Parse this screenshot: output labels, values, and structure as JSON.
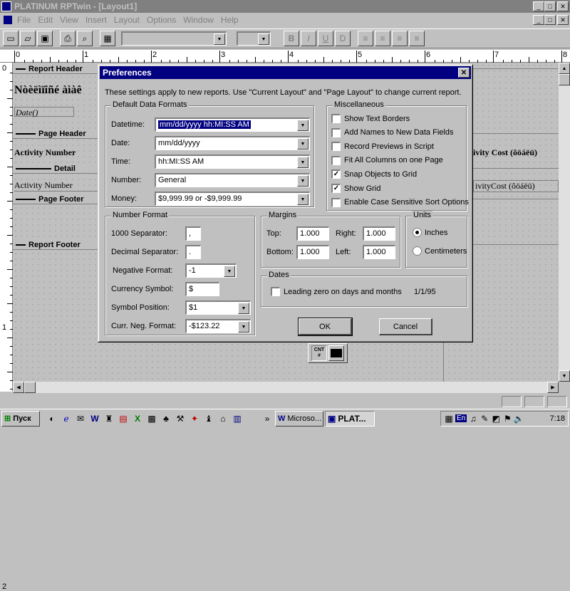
{
  "app": {
    "title": "PLATINUM RPTwin - [Layout1]",
    "win_min": "_",
    "win_max": "□",
    "win_close": "✕"
  },
  "menu": [
    "File",
    "Edit",
    "View",
    "Insert",
    "Layout",
    "Options",
    "Window",
    "Help"
  ],
  "toolbar": {
    "bold": "B",
    "italic": "I",
    "underline": "U",
    "strike": "D"
  },
  "ruler": {
    "labels": [
      "0",
      "1",
      "2",
      "3",
      "4",
      "5",
      "6",
      "7",
      "8"
    ],
    "vertical_labels": [
      "0",
      "1",
      "2"
    ]
  },
  "report": {
    "sections": [
      "Report Header",
      "Page Header",
      "Detail",
      "Page Footer",
      "Report Footer"
    ],
    "title_text": "Nòèëìïîñé àìàê",
    "date_text": "Date()",
    "col_left_header": "Activity Number",
    "col_right_header": "ivity Cost (ôöáëü)",
    "detail_left": "Activity Number",
    "detail_right": "ivityCost (ôöáëü)",
    "tool_cnt": "CNT #"
  },
  "dialog": {
    "title": "Preferences",
    "close": "✕",
    "description": "These settings apply to new reports.  Use \"Current Layout\" and \"Page Layout\" to change current report.",
    "default_formats": {
      "label": "Default Data Formats",
      "rows": [
        {
          "label": "Datetime:",
          "value": "mm/dd/yyyy hh:MI:SS AM"
        },
        {
          "label": "Date:",
          "value": "mm/dd/yyyy"
        },
        {
          "label": "Time:",
          "value": "hh:MI:SS AM"
        },
        {
          "label": "Number:",
          "value": "General"
        },
        {
          "label": "Money:",
          "value": "$9,999.99 or -$9,999.99"
        }
      ]
    },
    "misc": {
      "label": "Miscellaneous",
      "items": [
        {
          "label": "Show Text Borders",
          "checked": false
        },
        {
          "label": "Add Names to New Data Fields",
          "checked": false
        },
        {
          "label": "Record Previews in Script",
          "checked": false
        },
        {
          "label": "Fit All Columns on one Page",
          "checked": false
        },
        {
          "label": "Snap Objects to Grid",
          "checked": true
        },
        {
          "label": "Show Grid",
          "checked": true
        },
        {
          "label": "Enable Case Sensitive Sort Options",
          "checked": false
        }
      ]
    },
    "number_format": {
      "label": "Number Format",
      "thousand_label": "1000 Separator:",
      "thousand_value": ",",
      "decimal_label": "Decimal Separator:",
      "decimal_value": ".",
      "negative_label": "Negative Format:",
      "negative_value": "-1",
      "currency_label": "Currency Symbol:",
      "currency_value": "$",
      "symbol_pos_label": "Symbol Position:",
      "symbol_pos_value": "$1",
      "curr_neg_label": "Curr. Neg. Format:",
      "curr_neg_value": "-$123.22"
    },
    "margins": {
      "label": "Margins",
      "top_label": "Top:",
      "top_value": "1.000",
      "right_label": "Right:",
      "right_value": "1.000",
      "bottom_label": "Bottom:",
      "bottom_value": "1.000",
      "left_label": "Left:",
      "left_value": "1.000"
    },
    "units": {
      "label": "Units",
      "inches": "Inches",
      "centimeters": "Centimeters",
      "selected": "inches"
    },
    "dates": {
      "label": "Dates",
      "leading_zero": "Leading zero on days and months",
      "example": "1/1/95",
      "checked": false
    },
    "ok": "OK",
    "cancel": "Cancel"
  },
  "taskbar": {
    "start": "Пуск",
    "task1": "Microso...",
    "task2": "PLAT...",
    "lang": "En",
    "clock": "7:18"
  },
  "colors": {
    "titlebar": "#000080",
    "face": "#c0c0c0",
    "inactive_title": "#808080"
  }
}
